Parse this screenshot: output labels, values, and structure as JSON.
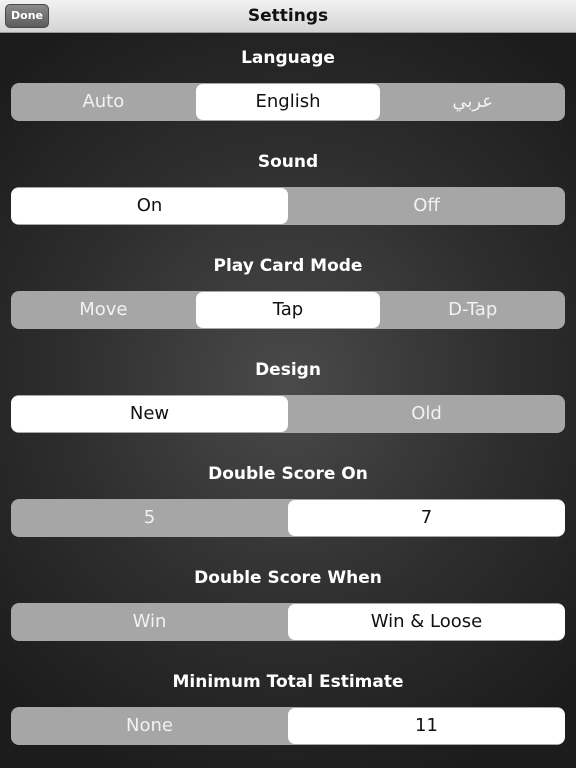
{
  "navbar": {
    "title": "Settings",
    "done_label": "Done"
  },
  "sections": [
    {
      "title": "Language",
      "options": [
        "Auto",
        "English",
        "عربي"
      ],
      "selected": 1
    },
    {
      "title": "Sound",
      "options": [
        "On",
        "Off"
      ],
      "selected": 0
    },
    {
      "title": "Play Card Mode",
      "options": [
        "Move",
        "Tap",
        "D-Tap"
      ],
      "selected": 1
    },
    {
      "title": "Design",
      "options": [
        "New",
        "Old"
      ],
      "selected": 0
    },
    {
      "title": "Double Score On",
      "options": [
        "5",
        "7"
      ],
      "selected": 1
    },
    {
      "title": "Double Score When",
      "options": [
        "Win",
        "Win & Loose"
      ],
      "selected": 1
    },
    {
      "title": "Minimum Total Estimate",
      "options": [
        "None",
        "11"
      ],
      "selected": 1
    }
  ]
}
